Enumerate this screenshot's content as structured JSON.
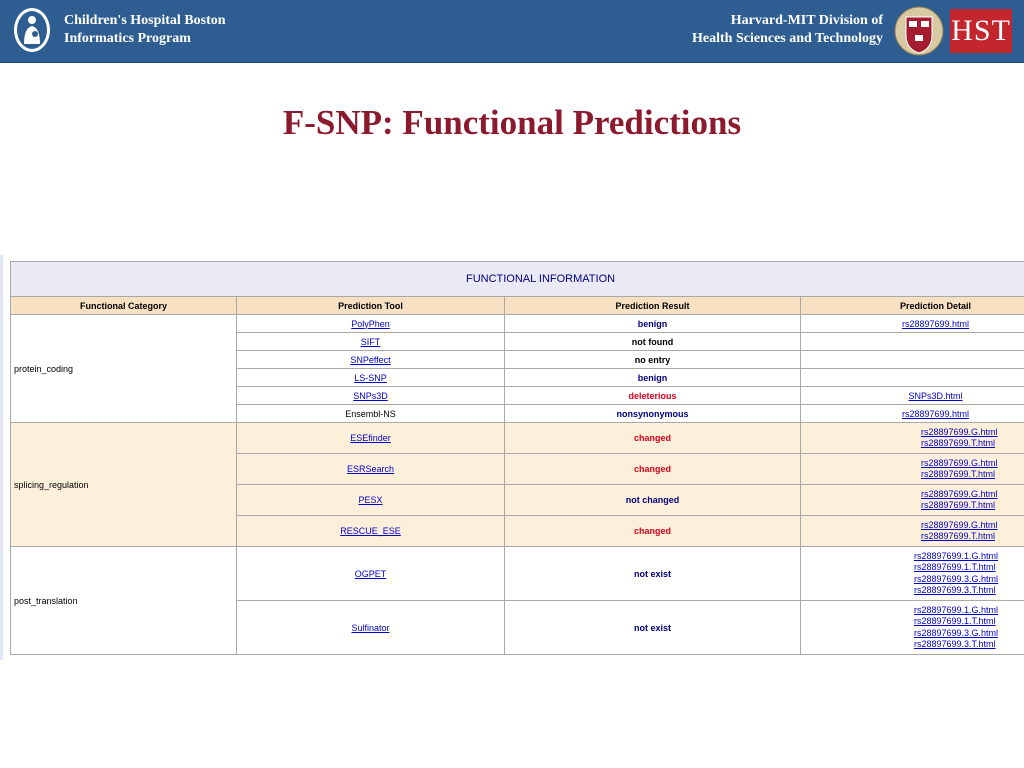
{
  "header": {
    "org_left_line1": "Children's Hospital Boston",
    "org_left_line2": "Informatics Program",
    "org_right_line1": "Harvard-MIT Division of",
    "org_right_line2": "Health Sciences and Technology",
    "hst_logo": "HST",
    "banner_color": "#2e5e91"
  },
  "slide": {
    "title": "F-SNP: Functional Predictions",
    "title_color": "#8b1a2e"
  },
  "table": {
    "caption": "FUNCTIONAL INFORMATION",
    "columns": [
      "Functional Category",
      "Prediction Tool",
      "Prediction Result",
      "Prediction Detail"
    ],
    "categories": [
      "protein_coding",
      "splicing_regulation",
      "post_translation"
    ],
    "rows": [
      {
        "tool": "PolyPhen",
        "result": "benign",
        "details": [
          "rs28897699.html"
        ]
      },
      {
        "tool": "SIFT",
        "result": "not found",
        "details": []
      },
      {
        "tool": "SNPeffect",
        "result": "no entry",
        "details": []
      },
      {
        "tool": "LS-SNP",
        "result": "benign",
        "details": []
      },
      {
        "tool": "SNPs3D",
        "result": "deleterious",
        "details": [
          "SNPs3D.html"
        ]
      },
      {
        "tool": "Ensembl-NS",
        "result": "nonsynonymous",
        "details": [
          "rs28897699.html"
        ]
      },
      {
        "tool": "ESEfinder",
        "result": "changed",
        "details": [
          "rs28897699.G.html",
          "rs28897699.T.html"
        ]
      },
      {
        "tool": "ESRSearch",
        "result": "changed",
        "details": [
          "rs28897699.G.html",
          "rs28897699.T.html"
        ]
      },
      {
        "tool": "PESX",
        "result": "not changed",
        "details": [
          "rs28897699.G.html",
          "rs28897699.T.html"
        ]
      },
      {
        "tool": "RESCUE_ESE",
        "result": "changed",
        "details": [
          "rs28897699.G.html",
          "rs28897699.T.html"
        ]
      },
      {
        "tool": "OGPET",
        "result": "not exist",
        "details": [
          "rs28897699.1.G.html",
          "rs28897699.1.T.html",
          "rs28897699.3.G.html",
          "rs28897699.3.T.html"
        ]
      },
      {
        "tool": "Sulfinator",
        "result": "not exist",
        "details": [
          "rs28897699.1.G.html",
          "rs28897699.1.T.html",
          "rs28897699.3.G.html",
          "rs28897699.3.T.html"
        ]
      }
    ],
    "colors": {
      "caption_bg": "#e9eaf6",
      "header_bg": "#f8e1c3",
      "splicing_bg": "#fdf0db",
      "result_blue": "#000080",
      "result_red": "#e0001b",
      "link": "#0000cc"
    }
  }
}
